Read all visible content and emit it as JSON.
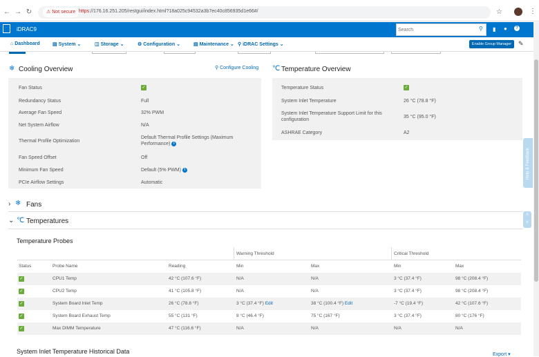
{
  "browser": {
    "back_icon": "back-arrow-icon",
    "forward_icon": "forward-arrow-icon",
    "reload_icon": "reload-icon",
    "security_label": "Not secure",
    "url_scheme": "https",
    "url_rest": "://176.16.251.205/restgui/index.html?18a025c94532a3b7ec40c856935d1e66#/"
  },
  "header": {
    "product": "iDRAC9",
    "search_placeholder": "Search"
  },
  "nav": {
    "items": [
      "Dashboard",
      "System",
      "Storage",
      "Configuration",
      "Maintenance",
      "iDRAC Settings"
    ],
    "group_manager": "Enable Group Manager"
  },
  "feedback_tab": "Help & Feedback",
  "cooling": {
    "title": "Cooling Overview",
    "configure_link": "Configure Cooling",
    "rows": [
      {
        "label": "Fan Status",
        "value": ""
      },
      {
        "label": "Redundancy Status",
        "value": "Full"
      },
      {
        "label": "Average Fan Speed",
        "value": "32% PWM"
      },
      {
        "label": "Net System Airflow",
        "value": "N/A"
      },
      {
        "label": "Thermal Profile Optimization",
        "value": "Default Thermal Profile Settings (Maximum Performance)"
      },
      {
        "label": "Fan Speed Offset",
        "value": "Off"
      },
      {
        "label": "Minimum Fan Speed",
        "value": "Default (5% PWM)"
      },
      {
        "label": "PCIe Airflow Settings",
        "value": "Automatic"
      }
    ]
  },
  "temperature": {
    "title": "Temperature Overview",
    "rows": [
      {
        "label": "Temperature Status",
        "value": ""
      },
      {
        "label": "System Inlet Temperature",
        "value": "26 °C (78.8 °F)"
      },
      {
        "label": "System Inlet Temperature Support Limit for this configuration",
        "value": "35 °C (95.0 °F)"
      },
      {
        "label": "ASHRAE Category",
        "value": "A2"
      }
    ]
  },
  "sections": {
    "fans": "Fans",
    "temperatures": "Temperatures"
  },
  "probes": {
    "title": "Temperature Probes",
    "group_warning": "Warning Threshold",
    "group_critical": "Critical Threshold",
    "columns": [
      "Status",
      "Probe Name",
      "Reading",
      "Min",
      "Max",
      "Min",
      "Max"
    ],
    "rows": [
      {
        "name": "CPU1 Temp",
        "reading": "42 °C (107.6 °F)",
        "wmin": "N/A",
        "wmax": "N/A",
        "cmin": "3 °C (37.4 °F)",
        "cmax": "98 °C (208.4 °F)",
        "edit_min": "",
        "edit_max": ""
      },
      {
        "name": "CPU2 Temp",
        "reading": "41 °C (105.8 °F)",
        "wmin": "N/A",
        "wmax": "N/A",
        "cmin": "3 °C (37.4 °F)",
        "cmax": "98 °C (208.4 °F)",
        "edit_min": "",
        "edit_max": ""
      },
      {
        "name": "System Board Inlet Temp",
        "reading": "26 °C (78.8 °F)",
        "wmin": "3 °C (37.4 °F)",
        "wmax": "38 °C (100.4 °F)",
        "cmin": "-7 °C (19.4 °F)",
        "cmax": "42 °C (107.6 °F)",
        "edit_min": "Edit",
        "edit_max": "Edit"
      },
      {
        "name": "System Board Exhaust Temp",
        "reading": "55 °C (131 °F)",
        "wmin": "8 °C (46.4 °F)",
        "wmax": "75 °C (167 °F)",
        "cmin": "3 °C (37.4 °F)",
        "cmax": "80 °C (176 °F)",
        "edit_min": "",
        "edit_max": ""
      },
      {
        "name": "Max DIMM Temperature",
        "reading": "47 °C (116.6 °F)",
        "wmin": "N/A",
        "wmax": "N/A",
        "cmin": "N/A",
        "cmax": "N/A",
        "edit_min": "",
        "edit_max": ""
      }
    ]
  },
  "history": {
    "title": "System Inlet Temperature Historical Data",
    "export": "Export"
  }
}
